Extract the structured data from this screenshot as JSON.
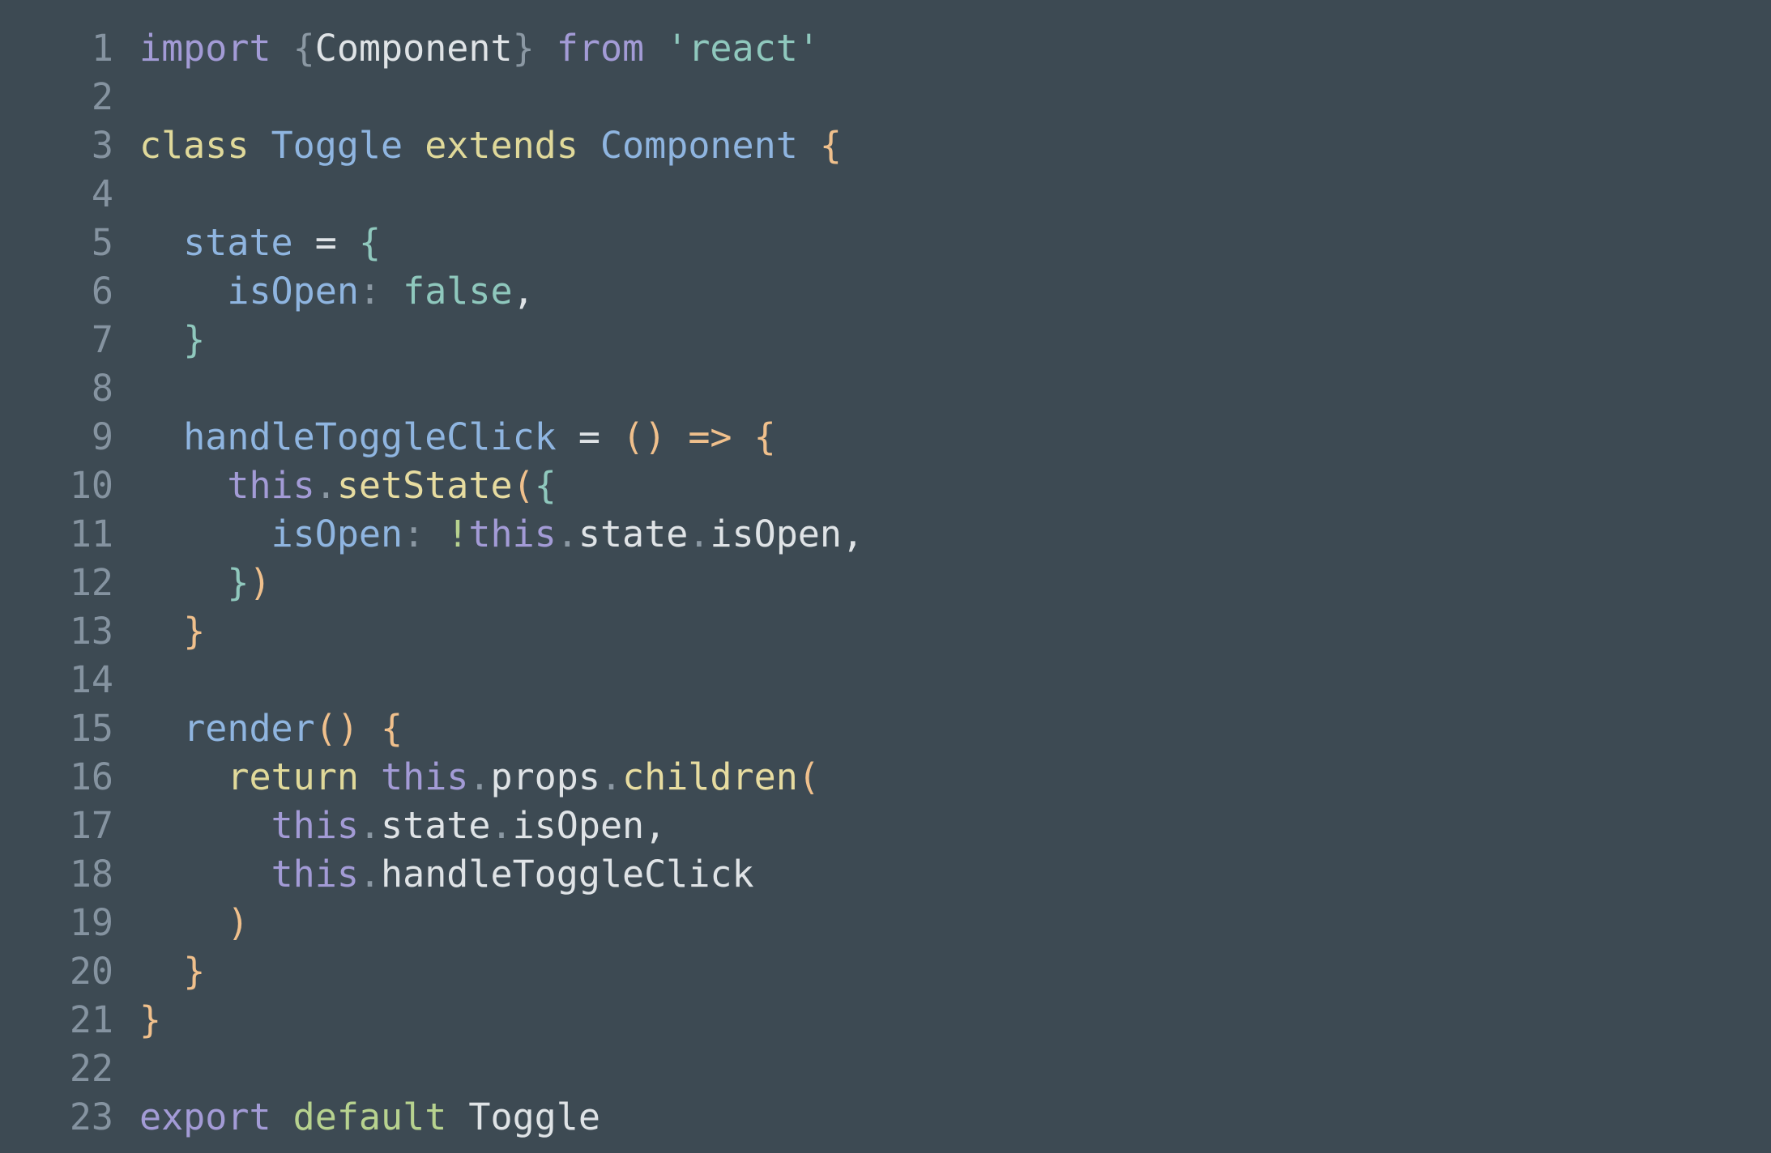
{
  "colors": {
    "background": "#3d4a53",
    "line_number": "#8593a0",
    "kw_purple": "#a39bd6",
    "kw_yellow": "#e0d99a",
    "type_blue": "#8fb5e0",
    "prop_blue": "#8fb5e0",
    "string_teal": "#8fc8bd",
    "brace_orange": "#f0c08c",
    "brace_teal": "#8fc8bd",
    "plain": "#dfe3e6",
    "punct": "#8b98a3",
    "default_green": "#b7d28f",
    "method_yellow": "#e7dca0"
  },
  "lines": [
    {
      "n": "1",
      "tokens": [
        {
          "t": "import",
          "c": "kw_purple"
        },
        {
          "t": " ",
          "c": "plain"
        },
        {
          "t": "{",
          "c": "punct"
        },
        {
          "t": "Component",
          "c": "plain"
        },
        {
          "t": "}",
          "c": "punct"
        },
        {
          "t": " ",
          "c": "plain"
        },
        {
          "t": "from",
          "c": "kw_purple"
        },
        {
          "t": " ",
          "c": "plain"
        },
        {
          "t": "'react'",
          "c": "string_teal"
        }
      ]
    },
    {
      "n": "2",
      "tokens": []
    },
    {
      "n": "3",
      "tokens": [
        {
          "t": "class",
          "c": "kw_yellow"
        },
        {
          "t": " ",
          "c": "plain"
        },
        {
          "t": "Toggle",
          "c": "type_blue"
        },
        {
          "t": " ",
          "c": "plain"
        },
        {
          "t": "extends",
          "c": "kw_yellow"
        },
        {
          "t": " ",
          "c": "plain"
        },
        {
          "t": "Component",
          "c": "type_blue"
        },
        {
          "t": " ",
          "c": "plain"
        },
        {
          "t": "{",
          "c": "brace_orange"
        }
      ]
    },
    {
      "n": "4",
      "tokens": []
    },
    {
      "n": "5",
      "tokens": [
        {
          "t": "  ",
          "c": "plain"
        },
        {
          "t": "state",
          "c": "prop_blue"
        },
        {
          "t": " = ",
          "c": "plain"
        },
        {
          "t": "{",
          "c": "brace_teal"
        }
      ]
    },
    {
      "n": "6",
      "tokens": [
        {
          "t": "    ",
          "c": "plain"
        },
        {
          "t": "isOpen",
          "c": "prop_blue"
        },
        {
          "t": ":",
          "c": "punct"
        },
        {
          "t": " ",
          "c": "plain"
        },
        {
          "t": "false",
          "c": "string_teal"
        },
        {
          "t": ",",
          "c": "plain"
        }
      ]
    },
    {
      "n": "7",
      "tokens": [
        {
          "t": "  ",
          "c": "plain"
        },
        {
          "t": "}",
          "c": "brace_teal"
        }
      ]
    },
    {
      "n": "8",
      "tokens": []
    },
    {
      "n": "9",
      "tokens": [
        {
          "t": "  ",
          "c": "plain"
        },
        {
          "t": "handleToggleClick",
          "c": "prop_blue"
        },
        {
          "t": " = ",
          "c": "plain"
        },
        {
          "t": "()",
          "c": "brace_orange"
        },
        {
          "t": " ",
          "c": "plain"
        },
        {
          "t": "=>",
          "c": "brace_orange"
        },
        {
          "t": " ",
          "c": "plain"
        },
        {
          "t": "{",
          "c": "brace_orange"
        }
      ]
    },
    {
      "n": "10",
      "tokens": [
        {
          "t": "    ",
          "c": "plain"
        },
        {
          "t": "this",
          "c": "kw_purple"
        },
        {
          "t": ".",
          "c": "punct"
        },
        {
          "t": "setState",
          "c": "method_yellow"
        },
        {
          "t": "(",
          "c": "brace_orange"
        },
        {
          "t": "{",
          "c": "brace_teal"
        }
      ]
    },
    {
      "n": "11",
      "tokens": [
        {
          "t": "      ",
          "c": "plain"
        },
        {
          "t": "isOpen",
          "c": "prop_blue"
        },
        {
          "t": ":",
          "c": "punct"
        },
        {
          "t": " ",
          "c": "plain"
        },
        {
          "t": "!",
          "c": "default_green"
        },
        {
          "t": "this",
          "c": "kw_purple"
        },
        {
          "t": ".",
          "c": "punct"
        },
        {
          "t": "state",
          "c": "plain"
        },
        {
          "t": ".",
          "c": "punct"
        },
        {
          "t": "isOpen",
          "c": "plain"
        },
        {
          "t": ",",
          "c": "plain"
        }
      ]
    },
    {
      "n": "12",
      "tokens": [
        {
          "t": "    ",
          "c": "plain"
        },
        {
          "t": "}",
          "c": "brace_teal"
        },
        {
          "t": ")",
          "c": "brace_orange"
        }
      ]
    },
    {
      "n": "13",
      "tokens": [
        {
          "t": "  ",
          "c": "plain"
        },
        {
          "t": "}",
          "c": "brace_orange"
        }
      ]
    },
    {
      "n": "14",
      "tokens": []
    },
    {
      "n": "15",
      "tokens": [
        {
          "t": "  ",
          "c": "plain"
        },
        {
          "t": "render",
          "c": "prop_blue"
        },
        {
          "t": "()",
          "c": "brace_orange"
        },
        {
          "t": " ",
          "c": "plain"
        },
        {
          "t": "{",
          "c": "brace_orange"
        }
      ]
    },
    {
      "n": "16",
      "tokens": [
        {
          "t": "    ",
          "c": "plain"
        },
        {
          "t": "return",
          "c": "kw_yellow"
        },
        {
          "t": " ",
          "c": "plain"
        },
        {
          "t": "this",
          "c": "kw_purple"
        },
        {
          "t": ".",
          "c": "punct"
        },
        {
          "t": "props",
          "c": "plain"
        },
        {
          "t": ".",
          "c": "punct"
        },
        {
          "t": "children",
          "c": "method_yellow"
        },
        {
          "t": "(",
          "c": "brace_orange"
        }
      ]
    },
    {
      "n": "17",
      "tokens": [
        {
          "t": "      ",
          "c": "plain"
        },
        {
          "t": "this",
          "c": "kw_purple"
        },
        {
          "t": ".",
          "c": "punct"
        },
        {
          "t": "state",
          "c": "plain"
        },
        {
          "t": ".",
          "c": "punct"
        },
        {
          "t": "isOpen",
          "c": "plain"
        },
        {
          "t": ",",
          "c": "plain"
        }
      ]
    },
    {
      "n": "18",
      "tokens": [
        {
          "t": "      ",
          "c": "plain"
        },
        {
          "t": "this",
          "c": "kw_purple"
        },
        {
          "t": ".",
          "c": "punct"
        },
        {
          "t": "handleToggleClick",
          "c": "plain"
        }
      ]
    },
    {
      "n": "19",
      "tokens": [
        {
          "t": "    ",
          "c": "plain"
        },
        {
          "t": ")",
          "c": "brace_orange"
        }
      ]
    },
    {
      "n": "20",
      "tokens": [
        {
          "t": "  ",
          "c": "plain"
        },
        {
          "t": "}",
          "c": "brace_orange"
        }
      ]
    },
    {
      "n": "21",
      "tokens": [
        {
          "t": "}",
          "c": "brace_orange"
        }
      ]
    },
    {
      "n": "22",
      "tokens": []
    },
    {
      "n": "23",
      "tokens": [
        {
          "t": "export",
          "c": "kw_purple"
        },
        {
          "t": " ",
          "c": "plain"
        },
        {
          "t": "default",
          "c": "default_green"
        },
        {
          "t": " ",
          "c": "plain"
        },
        {
          "t": "Toggle",
          "c": "plain"
        }
      ]
    }
  ]
}
